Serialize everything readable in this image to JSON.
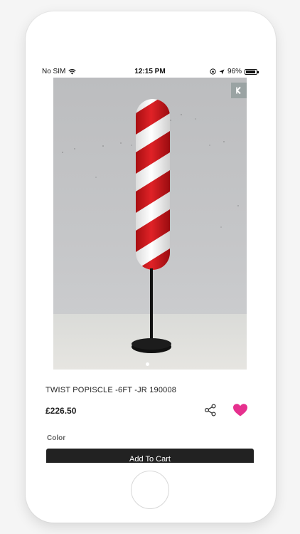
{
  "status_bar": {
    "carrier": "No SIM",
    "time": "12:15 PM",
    "battery_percent": "96%",
    "battery_level": 0.96
  },
  "product": {
    "title": "TWIST POPISCLE -6FT -JR 190008",
    "price": "£226.50",
    "color_label": "Color",
    "image_alt": "Red and white twisted popsicle sculpture on black stand",
    "carousel_current": 1,
    "carousel_total": 1
  },
  "actions": {
    "add_to_cart_label": "Add To Cart",
    "wishlist_color": "#e6308e",
    "share_icon": "share-icon",
    "close_icon": "chevron-left-icon"
  },
  "colors": {
    "button_bg": "#222222",
    "accent_pink": "#e6308e"
  }
}
